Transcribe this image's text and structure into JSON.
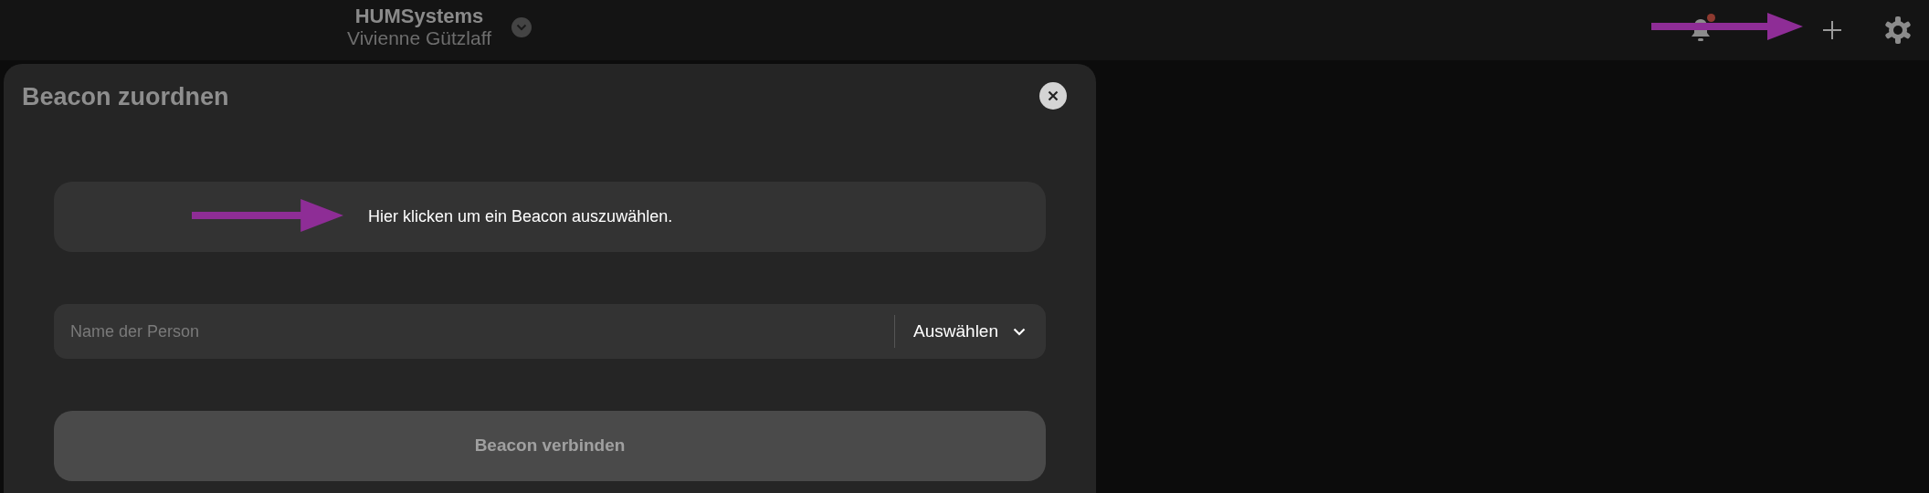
{
  "header": {
    "title": "HUMSystems",
    "subtitle": "Vivienne Gützlaff",
    "notification_unread": true,
    "annotation_arrow": true
  },
  "modal": {
    "title": "Beacon zuordnen",
    "beacon_picker": {
      "label": "Hier klicken um ein Beacon auszuwählen.",
      "annotation_arrow": true
    },
    "person_field": {
      "placeholder": "Name der Person",
      "dropdown_label": "Auswählen"
    },
    "submit_button": {
      "label": "Beacon verbinden",
      "disabled": true
    }
  }
}
